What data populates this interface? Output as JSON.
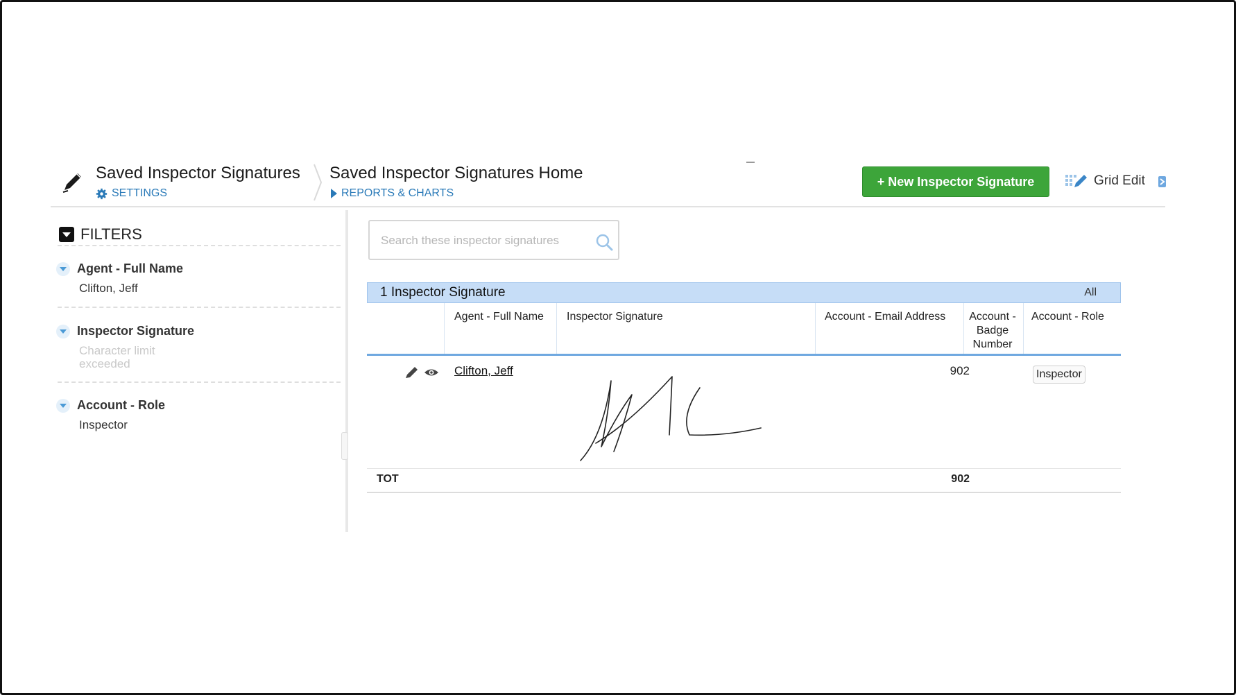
{
  "header": {
    "app_title": "Saved Inspector Signatures",
    "settings_label": "SETTINGS",
    "page_title": "Saved Inspector Signatures Home",
    "reports_label": "REPORTS & CHARTS",
    "new_button_label": "+ New Inspector Signature",
    "grid_edit_label": "Grid Edit",
    "icons": [
      "pen-icon",
      "gear-icon",
      "grid-edit-icon",
      "play-triangle-icon"
    ]
  },
  "filters": {
    "heading": "FILTERS",
    "items": [
      {
        "title": "Agent - Full Name",
        "value": "Clifton, Jeff"
      },
      {
        "title": "Inspector Signature",
        "value": "Character limit exceeded"
      },
      {
        "title": "Account - Role",
        "value": "Inspector"
      }
    ]
  },
  "search": {
    "placeholder": "Search these inspector signatures",
    "value": ""
  },
  "table": {
    "record_count_label": "1 Inspector Signature",
    "all_label": "All",
    "columns": [
      "Agent - Full Name",
      "Inspector Signature",
      "Account - Email Address",
      "Account - Badge Number",
      "Account - Role"
    ],
    "rows": [
      {
        "agent_full_name": "Clifton, Jeff",
        "inspector_signature": "signature-image",
        "email": "",
        "badge_number": "902",
        "role": "Inspector"
      }
    ],
    "totals": {
      "label": "TOT",
      "badge_number": "902"
    }
  },
  "colors": {
    "accent_blue": "#2a7ab8",
    "button_green": "#3da53a",
    "table_bar": "#c6ddf7",
    "header_underline": "#6fa8e0"
  }
}
